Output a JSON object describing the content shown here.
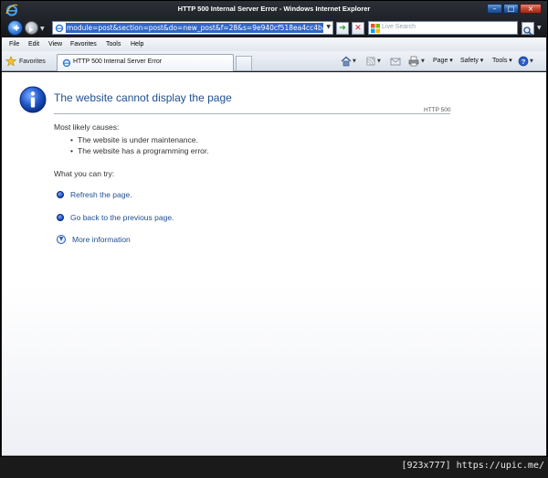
{
  "window": {
    "title": "HTTP 500 Internal Server Error - Windows Internet Explorer",
    "buttons": {
      "minimize": "–",
      "maximize": "□",
      "close": "×"
    }
  },
  "address_bar": {
    "url": "module=post&section=post&do=new_post&f=28&s=9e940cf518ea4cc4ba8f3fe2ba900ab2"
  },
  "search": {
    "placeholder": "Live Search"
  },
  "menu": {
    "items": [
      "File",
      "Edit",
      "View",
      "Favorites",
      "Tools",
      "Help"
    ]
  },
  "tabs": {
    "favorites_label": "Favorites",
    "active_tab_title": "HTTP 500 Internal Server Error"
  },
  "command_bar": {
    "page": "Page",
    "safety": "Safety",
    "tools": "Tools"
  },
  "content": {
    "title": "The website cannot display the page",
    "http_code": "HTTP 500",
    "causes_heading": "Most likely causes:",
    "causes": [
      "The website is under maintenance.",
      "The website has a programming error."
    ],
    "try_heading": "What you can try:",
    "actions": [
      "Refresh the page.",
      "Go back to the previous page."
    ],
    "more_info": "More information"
  },
  "watermark": "[923x777] https://upic.me/",
  "colors": {
    "title_blue": "#1f4f8f",
    "link_blue": "#1f4f8f",
    "url_highlight": "#3166c6"
  }
}
